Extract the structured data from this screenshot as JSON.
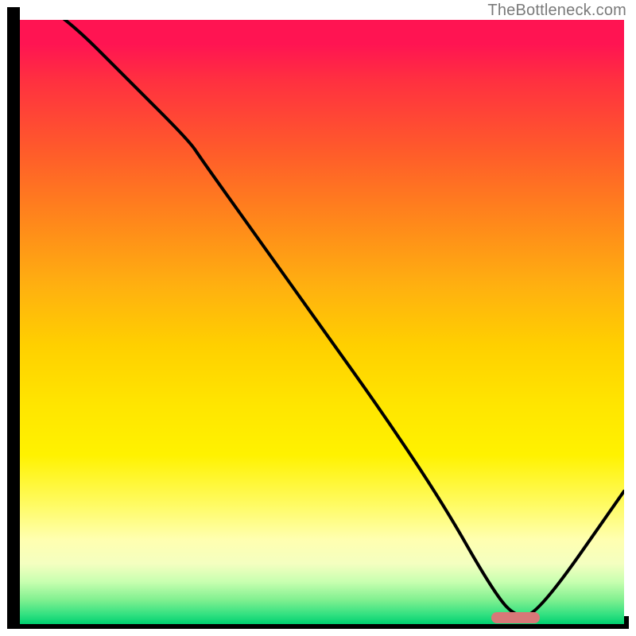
{
  "attribution": "TheBottleneck.com",
  "chart_data": {
    "type": "line",
    "title": "",
    "xlabel": "",
    "ylabel": "",
    "xlim": [
      0,
      100
    ],
    "ylim": [
      0,
      100
    ],
    "x": [
      0,
      8,
      18,
      28,
      30,
      40,
      50,
      60,
      70,
      78,
      82,
      86,
      100
    ],
    "values": [
      105,
      100,
      90,
      80,
      77,
      63,
      49,
      35,
      20,
      6,
      1,
      2,
      22
    ],
    "notes": "x is an arbitrary 0–100 horizontal scale; values are estimated heights of the black curve on a 0–100 vertical scale (0 = bottom). Curve starts off-top at left, descends roughly linearly to a minimum near x≈82, then rises toward the right edge.",
    "optimal_marker": {
      "x_start": 78,
      "x_end": 86,
      "y": 1
    },
    "background": "vertical hue gradient red→orange→yellow→green representing bottleneck severity"
  },
  "colors": {
    "marker": "#d87878",
    "curve": "#000000",
    "attribution": "#7a7a7a"
  }
}
